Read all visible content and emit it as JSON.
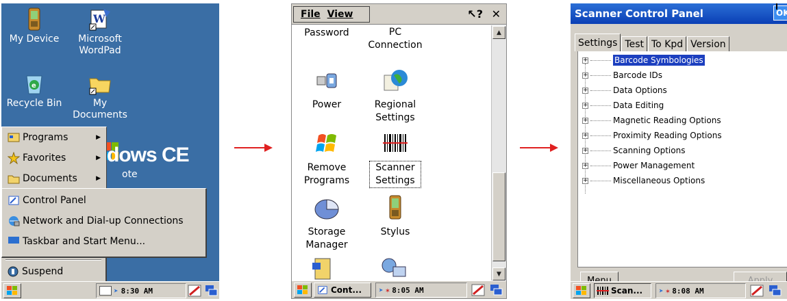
{
  "colors": {
    "desktop": "#3a6ea5",
    "arrow": "#e02020",
    "selection": "#1c3fbf",
    "titlebar": "#0a3fb5"
  },
  "screen1": {
    "desktop_icons": [
      {
        "label": "My Device",
        "icon": "device-icon"
      },
      {
        "label": "Microsoft WordPad",
        "icon": "wordpad-icon"
      },
      {
        "label": "Recycle Bin",
        "icon": "recycle-bin-icon"
      },
      {
        "label": "My Documents",
        "icon": "folder-icon"
      }
    ],
    "wallpaper_text": "dows CE",
    "partial_icon_text": "ote",
    "start_menu": {
      "top_items": [
        {
          "label": "Programs",
          "icon": "programs-icon"
        },
        {
          "label": "Favorites",
          "icon": "star-icon"
        },
        {
          "label": "Documents",
          "icon": "documents-icon"
        }
      ],
      "settings_items": [
        {
          "label": "Control Panel",
          "icon": "control-panel-icon"
        },
        {
          "label": "Network and Dial-up Connections",
          "icon": "network-icon"
        },
        {
          "label": "Taskbar and Start Menu...",
          "icon": "taskbar-icon"
        }
      ],
      "suspend_label": "Suspend"
    },
    "clock": "8:30 AM"
  },
  "screen2": {
    "menu": {
      "file": "File",
      "view": "View"
    },
    "items": [
      {
        "label": "Password",
        "icon": "password-icon"
      },
      {
        "label": "PC Connection",
        "icon": "pc-connection-icon"
      },
      {
        "label": "Power",
        "icon": "power-icon"
      },
      {
        "label": "Regional Settings",
        "icon": "globe-icon"
      },
      {
        "label": "Remove Programs",
        "icon": "remove-programs-icon"
      },
      {
        "label": "Scanner Settings",
        "icon": "barcode-icon"
      },
      {
        "label": "Storage Manager",
        "icon": "storage-icon"
      },
      {
        "label": "Stylus",
        "icon": "stylus-icon"
      }
    ],
    "task_label": "Cont...",
    "clock": "8:05 AM"
  },
  "screen3": {
    "title": "Scanner Control Panel",
    "ok_label": "OK",
    "tabs": [
      "Settings",
      "Test",
      "To Kpd",
      "Version"
    ],
    "tree": [
      "Barcode Symbologies",
      "Barcode IDs",
      "Data Options",
      "Data Editing",
      "Magnetic Reading Options",
      "Proximity Reading Options",
      "Scanning Options",
      "Power Management",
      "Miscellaneous Options"
    ],
    "menu_button": "Menu",
    "apply_button": "Apply",
    "task_label": "Scan...",
    "clock": "8:08 AM"
  }
}
